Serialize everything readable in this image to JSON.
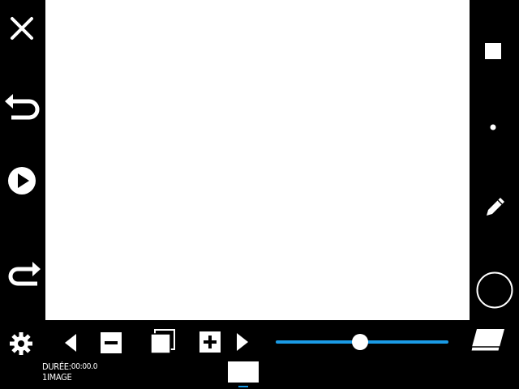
{
  "app": {
    "canvas_color": "#ffffff",
    "accent_color": "#1a9be6"
  },
  "left_toolbar": [
    {
      "name": "close",
      "icon": "x-icon"
    },
    {
      "name": "undo",
      "icon": "undo-arrow-icon"
    },
    {
      "name": "play",
      "icon": "play-circle-icon"
    },
    {
      "name": "redo",
      "icon": "redo-arrow-icon"
    }
  ],
  "right_toolbar": [
    {
      "name": "square-brush",
      "icon": "square-icon"
    },
    {
      "name": "dot-brush",
      "icon": "dot-icon"
    },
    {
      "name": "pencil-tool",
      "icon": "pencil-icon"
    },
    {
      "name": "color-picker",
      "icon": "circle-icon"
    }
  ],
  "bottom_toolbar": {
    "settings_icon": "gear-icon",
    "prev_icon": "triangle-left-icon",
    "delete_icon": "minus-box-icon",
    "duplicate_icon": "copy-frames-icon",
    "add_icon": "plus-box-icon",
    "next_icon": "triangle-right-icon",
    "eraser_icon": "eraser-icon"
  },
  "speed_slider": {
    "value": 0.49
  },
  "info": {
    "duration_label": "DURÉE:",
    "duration_value": "00:00.0",
    "frames_count": "1IMAGE"
  },
  "frames": {
    "selected": 1
  }
}
